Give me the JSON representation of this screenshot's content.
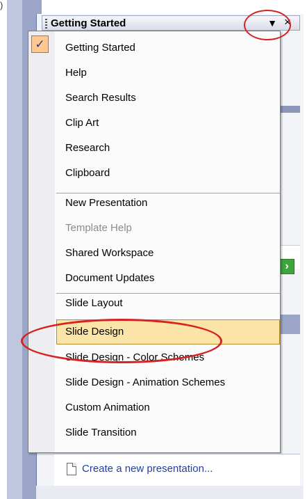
{
  "top_fragment": ")",
  "task_pane": {
    "title": "Getting Started",
    "dropdown_icon": "down-triangle-icon",
    "close_icon": "close-icon"
  },
  "menu": {
    "items": [
      {
        "label": "Getting Started",
        "checked": true
      },
      {
        "label": "Help"
      },
      {
        "label": "Search Results"
      },
      {
        "label": "Clip Art"
      },
      {
        "label": "Research"
      },
      {
        "label": "Clipboard"
      },
      {
        "label": "New Presentation"
      },
      {
        "label": "Template Help",
        "disabled": true
      },
      {
        "label": "Shared Workspace"
      },
      {
        "label": "Document Updates"
      },
      {
        "label": "Slide Layout"
      },
      {
        "label": "Slide Design",
        "highlighted": true
      },
      {
        "label": "Slide Design - Color Schemes"
      },
      {
        "label": "Slide Design - Animation Schemes"
      },
      {
        "label": "Custom Animation"
      },
      {
        "label": "Slide Transition"
      }
    ]
  },
  "bottom_link": "Create a new presentation...",
  "colors": {
    "annotation": "#d62222",
    "highlight": "#fbe4a8",
    "link": "#1f3fa6"
  }
}
